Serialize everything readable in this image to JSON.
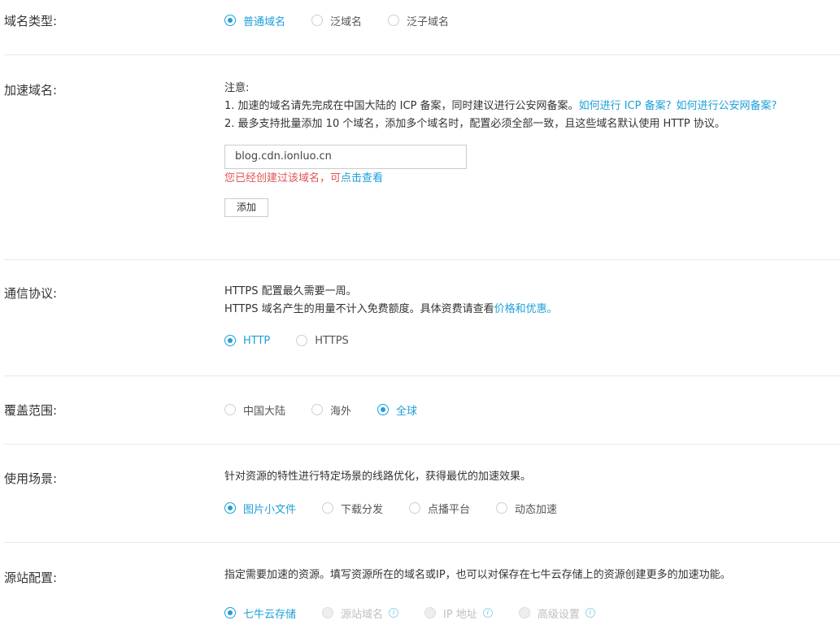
{
  "domain_type": {
    "label": "域名类型:",
    "options": [
      "普通域名",
      "泛域名",
      "泛子域名"
    ]
  },
  "accel_domain": {
    "label": "加速域名:",
    "note_title": "注意:",
    "note1_text": "1. 加速的域名请先完成在中国大陆的 ICP 备案，同时建议进行公安网备案。",
    "note1_link1": "如何进行 ICP 备案?",
    "note1_link2": "如何进行公安网备案?",
    "note2_text": "2. 最多支持批量添加 10 个域名，添加多个域名时，配置必须全部一致，且这些域名默认使用 HTTP 协议。",
    "input_value": "blog.cdn.ionluo.cn",
    "error_text": "您已经创建过该域名，可",
    "error_link": "点击查看",
    "add_button": "添加"
  },
  "protocol": {
    "label": "通信协议:",
    "line1": "HTTPS 配置最久需要一周。",
    "line2_text": "HTTPS 域名产生的用量不计入免费额度。具体资费请查看",
    "line2_link": "价格和优惠。",
    "options": [
      "HTTP",
      "HTTPS"
    ]
  },
  "coverage": {
    "label": "覆盖范围:",
    "options": [
      "中国大陆",
      "海外",
      "全球"
    ]
  },
  "scenario": {
    "label": "使用场景:",
    "desc": "针对资源的特性进行特定场景的线路优化，获得最优的加速效果。",
    "options": [
      "图片小文件",
      "下载分发",
      "点播平台",
      "动态加速"
    ]
  },
  "origin": {
    "label": "源站配置:",
    "desc": "指定需要加速的资源。填写资源所在的域名或IP，也可以对保存在七牛云存储上的资源创建更多的加速功能。",
    "options": [
      "七牛云存储",
      "源站域名",
      "IP 地址",
      "高级设置"
    ],
    "info_glyph": "i"
  },
  "colors": {
    "accent": "#1e9fd8",
    "error": "#e05555"
  }
}
